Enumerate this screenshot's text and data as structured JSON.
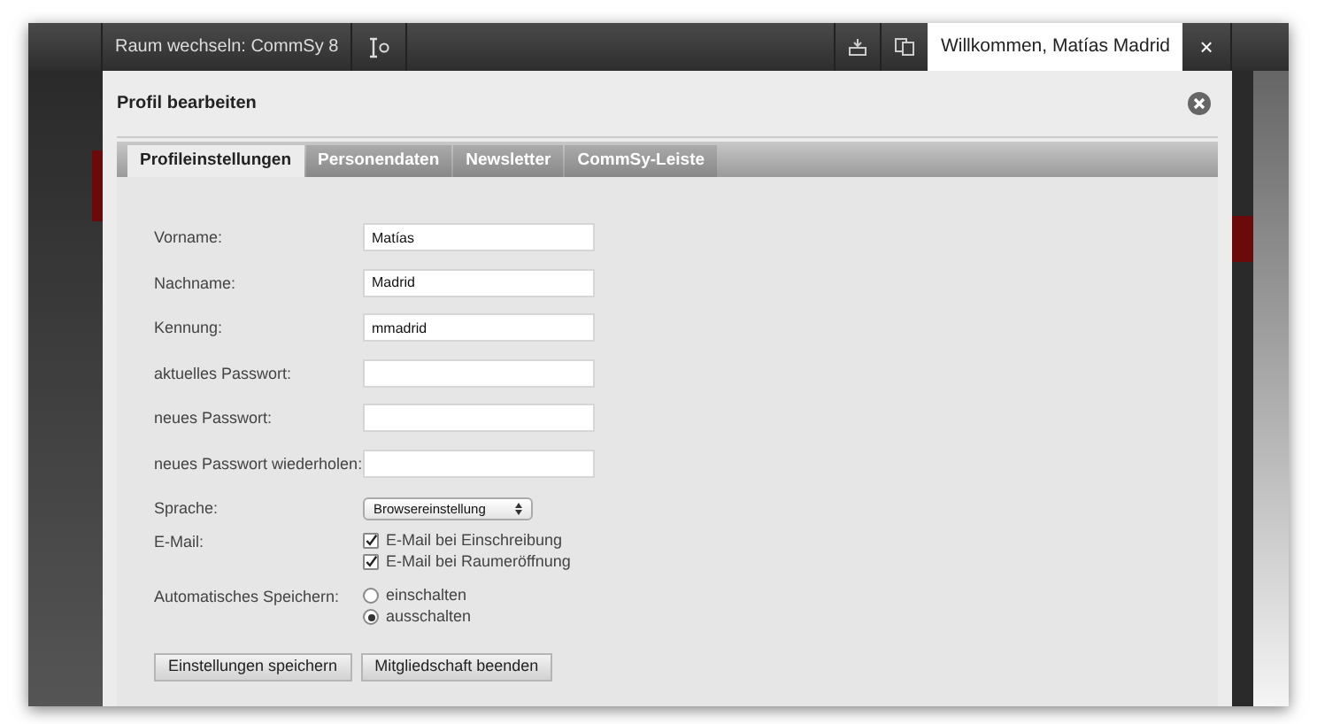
{
  "top_bar": {
    "room_switch": "Raum wechseln: CommSy 8",
    "welcome": "Willkommen, Matías Madrid",
    "close": "×"
  },
  "dialog": {
    "title": "Profil bearbeiten",
    "tabs": [
      {
        "label": "Profileinstellungen",
        "selected": true
      },
      {
        "label": "Personendaten",
        "selected": false
      },
      {
        "label": "Newsletter",
        "selected": false
      },
      {
        "label": "CommSy-Leiste",
        "selected": false
      }
    ],
    "rows": [
      {
        "kind": "text",
        "label": "Vorname:",
        "value": "Matías"
      },
      {
        "kind": "text",
        "label": "Nachname:",
        "value": "Madrid"
      },
      {
        "kind": "text",
        "label": "Kennung:",
        "value": "mmadrid"
      },
      {
        "kind": "text",
        "label": "aktuelles Passwort:"
      },
      {
        "kind": "text",
        "label": "neues Passwort:"
      },
      {
        "kind": "text",
        "label": "neues Passwort wiederholen:"
      },
      {
        "kind": "select",
        "label": "Sprache:",
        "value": "Browsereinstellung"
      },
      {
        "kind": "checkboxes",
        "label": "E-Mail:",
        "options": [
          {
            "label": "E-Mail bei Einschreibung",
            "checked": true
          },
          {
            "label": "E-Mail bei Raumeröffnung",
            "checked": true
          }
        ]
      },
      {
        "kind": "radios",
        "label": "Automatisches Speichern:",
        "options": [
          {
            "label": "einschalten",
            "selected": false
          },
          {
            "label": "ausschalten",
            "selected": true
          }
        ]
      }
    ],
    "buttons": [
      "Einstellungen speichern",
      "Mitgliedschaft beenden"
    ]
  }
}
